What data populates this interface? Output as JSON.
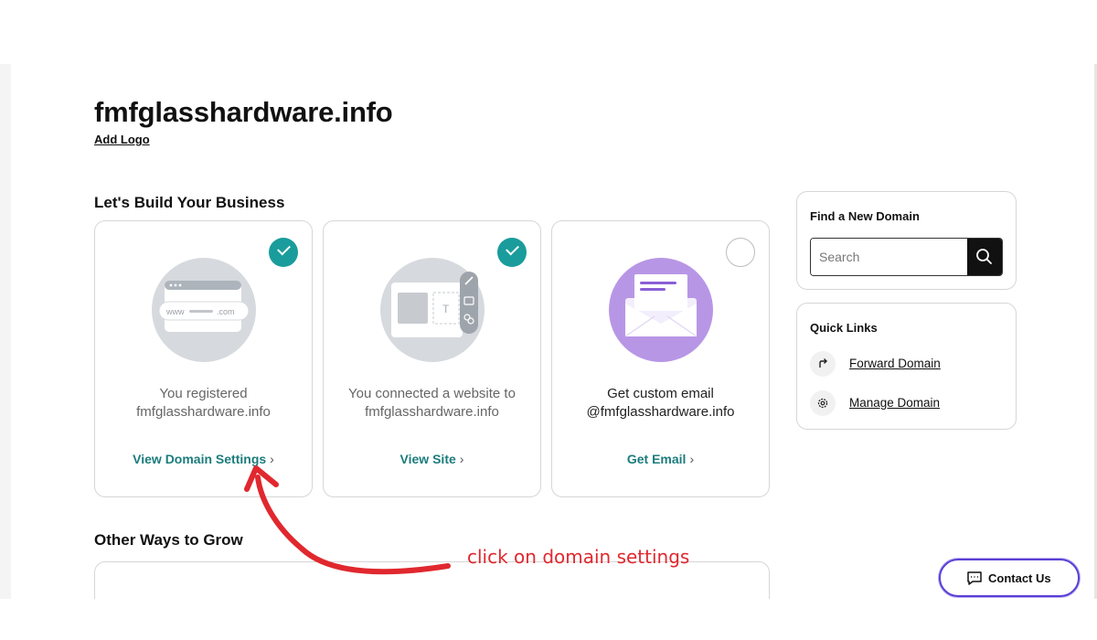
{
  "domain": {
    "title": "fmfglasshardware.info",
    "add_logo": "Add Logo"
  },
  "build_section": {
    "heading": "Let's Build Your Business",
    "cards": [
      {
        "status": "completed",
        "text_line1": "You registered",
        "text_line2": "fmfglasshardware.info",
        "link": "View Domain Settings",
        "illustration_icon": "domain-browser-icon",
        "illustration_text_www": "www",
        "illustration_text_com": ".com"
      },
      {
        "status": "completed",
        "text_line1": "You connected a website to",
        "text_line2": "fmfglasshardware.info",
        "link": "View Site",
        "illustration_icon": "website-builder-icon"
      },
      {
        "status": "not-started",
        "text_line1": "Get custom email",
        "text_line2": "@fmfglasshardware.info",
        "link": "Get Email",
        "illustration_icon": "envelope-icon"
      }
    ]
  },
  "grow_section": {
    "heading": "Other Ways to Grow"
  },
  "find_domain": {
    "title": "Find a New Domain",
    "search_placeholder": "Search",
    "search_icon": "search-icon"
  },
  "quick_links": {
    "title": "Quick Links",
    "items": [
      {
        "label": "Forward Domain",
        "icon": "forward-arrow-icon"
      },
      {
        "label": "Manage Domain",
        "icon": "gear-icon"
      }
    ]
  },
  "annotation": {
    "text": "click on domain settings"
  },
  "contact": {
    "label": "Contact Us",
    "icon": "chat-icon"
  },
  "colors": {
    "teal_check": "#1a9c9c",
    "link_teal": "#1c7c7c",
    "purple_illustration": "#b896e6",
    "annotation_red": "#e0282e",
    "contact_border": "#5b3fd6"
  }
}
